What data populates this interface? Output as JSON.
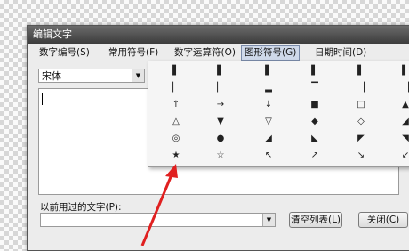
{
  "window": {
    "title": "编辑文字"
  },
  "menu": [
    {
      "label": "数字编号(S)"
    },
    {
      "label": "常用符号(F)"
    },
    {
      "label": "数字运算符(O)"
    },
    {
      "label": "图形符号(G)"
    },
    {
      "label": "日期时间(D)"
    }
  ],
  "font": {
    "value": "宋体"
  },
  "used_text": {
    "label": "以前用过的文字(P):",
    "value": ""
  },
  "buttons": {
    "clear": "清空列表(L)",
    "close": "关闭(C)"
  },
  "symbols": [
    [
      "▌",
      "▌",
      "▌",
      "▌",
      "▌",
      "▌"
    ],
    [
      "▏",
      "▏",
      "▂",
      "▔",
      "▕",
      "▕"
    ],
    [
      "↑",
      "→",
      "↓",
      "■",
      "□",
      "▲"
    ],
    [
      "△",
      "▼",
      "▽",
      "◆",
      "◇",
      "◢"
    ],
    [
      "◎",
      "●",
      "◢",
      "◣",
      "◤",
      "◥"
    ],
    [
      "★",
      "☆",
      "↖",
      "↗",
      "↘",
      "↙"
    ]
  ],
  "colors": {
    "titlebar": "#4a4a4a",
    "annotation_arrow": "#e02020",
    "menu_active": "#cfd9ea"
  }
}
